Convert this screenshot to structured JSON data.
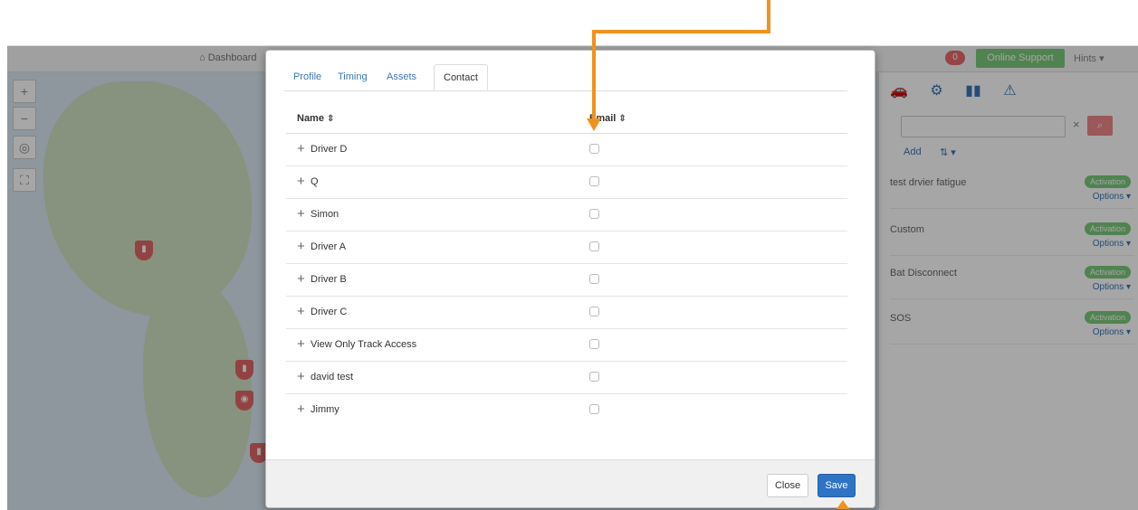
{
  "background": {
    "topbar": {
      "dashboard_label": "Dashboard",
      "notification_count": "0",
      "online_support_label": "Online Support",
      "hints_label": "Hints ▾"
    },
    "map": {
      "controls": [
        "+",
        "−",
        "◎",
        "⛶"
      ]
    },
    "right_panel": {
      "add_label": "Add",
      "sort_label": "⇅ ▾",
      "clear_label": "×",
      "alerts": [
        {
          "name": "test drvier fatigue",
          "status": "Activation",
          "options": "Options ▾"
        },
        {
          "name": "Custom",
          "status": "Activation",
          "options": "Options ▾"
        },
        {
          "name": "Bat Disconnect",
          "status": "Activation",
          "options": "Options ▾"
        },
        {
          "name": "SOS",
          "status": "Activation",
          "options": "Options ▾"
        }
      ]
    }
  },
  "modal": {
    "tabs": [
      {
        "label": "Profile",
        "active": false
      },
      {
        "label": "Timing",
        "active": false
      },
      {
        "label": "Assets",
        "active": false
      },
      {
        "label": "Contact",
        "active": true
      }
    ],
    "table": {
      "headers": {
        "name": "Name",
        "email": "Email",
        "sort_icon": "⇕"
      },
      "rows": [
        {
          "name": "Driver D"
        },
        {
          "name": "Q"
        },
        {
          "name": "Simon"
        },
        {
          "name": "Driver A"
        },
        {
          "name": "Driver B"
        },
        {
          "name": "Driver C"
        },
        {
          "name": "View Only Track Access"
        },
        {
          "name": "david test"
        },
        {
          "name": "Jimmy"
        }
      ]
    },
    "footer": {
      "close_label": "Close",
      "save_label": "Save"
    }
  },
  "colors": {
    "annotation_arrow": "#f0921f",
    "primary_button": "#2f73c4",
    "link": "#3a76b8"
  }
}
